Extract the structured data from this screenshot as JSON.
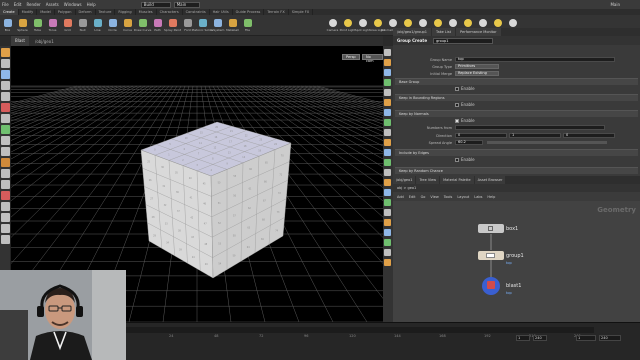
{
  "menubar": {
    "items": [
      "File",
      "Edit",
      "Render",
      "Assets",
      "Windows",
      "Help"
    ],
    "build_label": "Build",
    "desktop_field": "Build",
    "context_field": "Main",
    "right_label": "Main"
  },
  "shelf": {
    "tabs": [
      "Create",
      "Modify",
      "Model",
      "Polygon",
      "Deform",
      "Texture",
      "Rigging",
      "Muscles",
      "Characters",
      "Constraints",
      "Hair Utils",
      "Guide Process",
      "Terrain FX",
      "Simple FX",
      "Volume",
      "Lights and Cameras",
      "Collisions",
      "Particles",
      "Grains",
      "Vellum",
      "Rigid Bodies",
      "Particle Fluids",
      "Viscous Fluids",
      "Oceans",
      "Pyro FX",
      "FEM"
    ],
    "left_tools": [
      "Box",
      "Sphere",
      "Tube",
      "Torus",
      "Grid",
      "Null",
      "Line",
      "Circle",
      "Curve",
      "Draw Curve",
      "Path",
      "Spray Paint",
      "Font",
      "Platonic Solids",
      "L-System",
      "Metaball",
      "File"
    ],
    "right_tools": [
      "Camera",
      "Point Light",
      "Spot Light",
      "Area Light",
      "Geometry Light",
      "Volume Light",
      "Distant Light",
      "Environment Light",
      "Sky Light",
      "GI Light",
      "Caustic Light",
      "Portal Light",
      "Ambient Light"
    ]
  },
  "viewport": {
    "tab": "Blast",
    "path_label": "/obj/geo1",
    "persp_button": "Persp",
    "cam_button": "No cam"
  },
  "timeline": {
    "ticks": [
      "1",
      "24",
      "48",
      "72",
      "96",
      "120",
      "144",
      "168",
      "192",
      "216",
      "240"
    ],
    "start_field": "1",
    "end_field": "240",
    "current": "1",
    "end_current": "240"
  },
  "param_panel": {
    "tabs": [
      "/obj/geo1/group1",
      "Take List",
      "Performance Monitor"
    ],
    "node_type": "Group Create",
    "node_name": "group1",
    "rows": [
      {
        "label": "Group Name",
        "value": "top",
        "kind": "field"
      },
      {
        "label": "Group Type",
        "value": "Primitives",
        "kind": "menu"
      },
      {
        "label": "Initial Merge",
        "value": "Replace Existing",
        "kind": "menu"
      }
    ],
    "sections": [
      {
        "title": "Base Group",
        "check_label": "Enable",
        "checked": false
      },
      {
        "title": "Keep in Bounding Regions",
        "check_label": "Enable",
        "checked": false
      },
      {
        "title": "Keep by Normals",
        "check_label": "Enable",
        "checked": true
      },
      {
        "title": "Include by Edges",
        "check_label": "Enable",
        "checked": false
      },
      {
        "title": "Keep by Random Chance",
        "check_label": "",
        "checked": false
      }
    ],
    "normals": {
      "numbers_from_label": "Numbers from",
      "direction_label": "Direction",
      "direction": [
        "0",
        "1",
        "0"
      ],
      "spread_label": "Spread Angle",
      "spread_value": "60.2"
    }
  },
  "network": {
    "tabs": [
      "/obj/geo1",
      "Tree View",
      "Material Palette",
      "Asset Browser"
    ],
    "path": "obj  >  geo1",
    "menu": [
      "Add",
      "Edit",
      "Go",
      "View",
      "Tools",
      "Layout",
      "Labs",
      "Help"
    ],
    "context_label": "Geometry",
    "nodes": [
      {
        "name": "box1",
        "sub": "",
        "color": "#c9c9c9"
      },
      {
        "name": "group1",
        "sub": "top",
        "color": "#e0d6c4"
      },
      {
        "name": "blast1",
        "sub": "top",
        "color": "#3a5fd0"
      }
    ]
  },
  "colors": {
    "accent": "#ff9b2a",
    "viewport_bg": "#000000",
    "cube_face": "#d6d6d6",
    "cube_top": "#c9c9df",
    "node_blue": "#7ab3ff"
  }
}
